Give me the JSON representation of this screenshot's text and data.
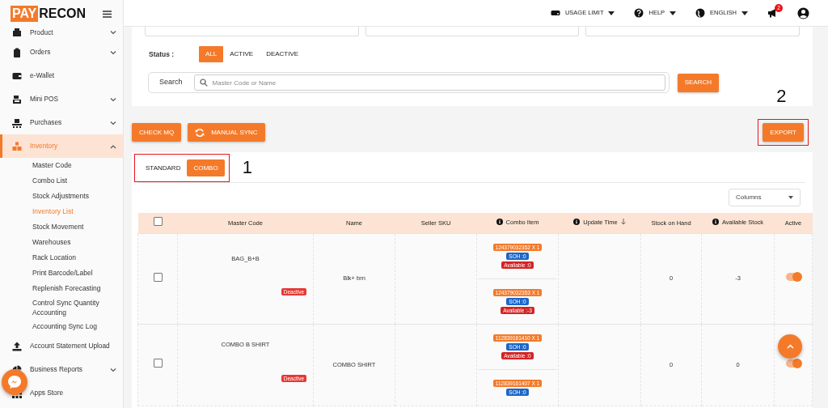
{
  "brand": {
    "part_1": "PAY",
    "part_2": "RECON"
  },
  "header": {
    "menus": [
      {
        "kind": "usage",
        "label": "USAGE LIMIT"
      },
      {
        "kind": "help",
        "label": "HELP"
      },
      {
        "kind": "language",
        "label": "ENGLISH"
      }
    ],
    "notification_count": "2"
  },
  "sidebar": {
    "items": [
      {
        "label": "Product",
        "expandable": true,
        "expanded": false,
        "selected": false
      },
      {
        "label": "Orders",
        "expandable": true,
        "expanded": false,
        "selected": false
      },
      {
        "label": "e-Wallet",
        "expandable": false,
        "expanded": false,
        "selected": false
      },
      {
        "label": "Mini POS",
        "expandable": true,
        "expanded": false,
        "selected": false
      },
      {
        "label": "Purchases",
        "expandable": true,
        "expanded": false,
        "selected": false
      },
      {
        "label": "Inventory",
        "expandable": true,
        "expanded": true,
        "selected": true,
        "children": [
          {
            "label": "Master Code",
            "selected": false
          },
          {
            "label": "Combo List",
            "selected": false
          },
          {
            "label": "Stock Adjustments",
            "selected": false
          },
          {
            "label": "Inventory List",
            "selected": true
          },
          {
            "label": "Stock Movement",
            "selected": false
          },
          {
            "label": "Warehouses",
            "selected": false
          },
          {
            "label": "Rack Location",
            "selected": false
          },
          {
            "label": "Print Barcode/Label",
            "selected": false
          },
          {
            "label": "Replenish Forecasting",
            "selected": false
          },
          {
            "label": "Control Sync Quantity Accounting",
            "selected": false
          },
          {
            "label": "Accounting Sync Log",
            "selected": false
          }
        ]
      },
      {
        "label": "Account Statement Upload",
        "expandable": false,
        "expanded": false,
        "selected": false
      },
      {
        "label": "Business Reports",
        "expandable": true,
        "expanded": false,
        "selected": false
      },
      {
        "label": "Apps Store",
        "expandable": false,
        "expanded": false,
        "selected": false
      }
    ]
  },
  "filters": {
    "status_label": "Status :",
    "status_options": [
      {
        "label": "ALL",
        "selected": true
      },
      {
        "label": "ACTIVE",
        "selected": false
      },
      {
        "label": "DEACTIVE",
        "selected": false
      }
    ],
    "search_label": "Search",
    "search_placeholder": "Master Code or Name",
    "search_button": "SEARCH"
  },
  "actions": [
    {
      "kind": "plain",
      "label": "CHECK MQ"
    },
    {
      "kind": "sync",
      "label": "MANUAL SYNC"
    }
  ],
  "export_button": "EXPORT",
  "tabs": [
    {
      "label": "STANDARD",
      "selected": false
    },
    {
      "label": "COMBO",
      "selected": true
    }
  ],
  "columns_button": "Columns",
  "table": {
    "header_checked": false,
    "columns": [
      {
        "label": "Master Code",
        "info": false,
        "sorted": false
      },
      {
        "label": "Name",
        "info": false,
        "sorted": false
      },
      {
        "label": "Seller SKU",
        "info": false,
        "sorted": false
      },
      {
        "label": "Combo Item",
        "info": true,
        "sorted": false
      },
      {
        "label": "Update Time",
        "info": true,
        "sorted": true
      },
      {
        "label": "Stock on Hand",
        "info": false,
        "sorted": false
      },
      {
        "label": "Available Stock",
        "info": true,
        "sorted": false
      },
      {
        "label": "Active",
        "info": false,
        "sorted": false
      }
    ],
    "rows": [
      {
        "checked": false,
        "master_code": "BAG_B+B",
        "status": "Deactive",
        "name": "Blk+ brn",
        "combo_items": [
          {
            "code": "124379032352 X 1",
            "soh": "SOH :0",
            "available": "Available :0"
          },
          {
            "code": "124379032353 X 1",
            "soh": "SOH :0",
            "available": "Available :-3"
          }
        ],
        "stock_on_hand": "0",
        "available_stock": "-3",
        "active": true
      },
      {
        "checked": false,
        "master_code": "COMBO B SHIRT",
        "status": "Deactive",
        "name": "COMBO SHIRT",
        "combo_items": [
          {
            "code": "112839161410 X 1",
            "soh": "SOH :0",
            "available": "Available :0"
          },
          {
            "code": "112839161407 X 1",
            "soh": "SOH :0"
          }
        ],
        "stock_on_hand": "0",
        "available_stock": "0",
        "active": true
      }
    ]
  },
  "annotations": [
    {
      "label": "1"
    },
    {
      "label": "2"
    }
  ]
}
